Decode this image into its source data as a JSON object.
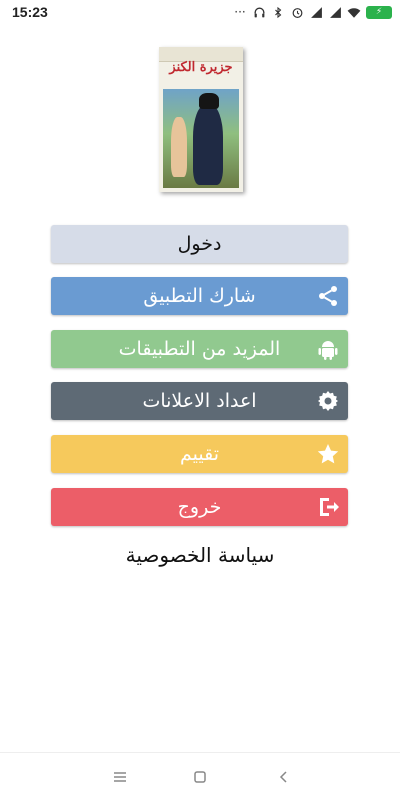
{
  "status_bar": {
    "time": "15:23",
    "battery": "⚡"
  },
  "cover": {
    "title": "جزيرة الكنز"
  },
  "buttons": [
    {
      "id": "login",
      "label": "دخول",
      "color": "#d6dce8",
      "icon": ""
    },
    {
      "id": "share",
      "label": "شارك التطبيق",
      "color": "#6a9bd2",
      "icon": "share-icon"
    },
    {
      "id": "more_apps",
      "label": "المزيد من التطبيقات",
      "color": "#91c98f",
      "icon": "android-icon"
    },
    {
      "id": "ad_settings",
      "label": "اعداد الاعلانات",
      "color": "#5e6a75",
      "icon": "gear-icon"
    },
    {
      "id": "rate",
      "label": "تقييم",
      "color": "#f6c95c",
      "icon": "star-icon"
    },
    {
      "id": "exit",
      "label": "خروج",
      "color": "#ec5e68",
      "icon": "exit-icon"
    }
  ],
  "privacy_link": "سياسة الخصوصية",
  "nav": {
    "menu_icon": "menu-icon",
    "home_icon": "home-icon",
    "back_icon": "back-icon"
  }
}
